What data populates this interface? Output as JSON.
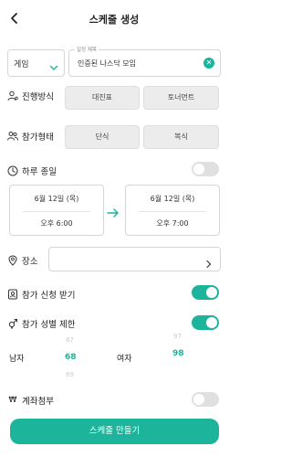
{
  "header": {
    "title": "스케줄 생성",
    "back_icon": "back-arrow-icon"
  },
  "game": {
    "value": "게임"
  },
  "title_field": {
    "label": "일정 제목",
    "value": "인증된 나스닥 모임"
  },
  "progress": {
    "label": "진행방식",
    "options": [
      "대진표",
      "토너먼트"
    ]
  },
  "participation": {
    "label": "참가형태",
    "options": [
      "단식",
      "복식"
    ]
  },
  "all_day": {
    "label": "하루 종일",
    "enabled": false
  },
  "start": {
    "date": "6월 12일 (목)",
    "time": "오후 6:00"
  },
  "end": {
    "date": "6월 12일 (목)",
    "time": "오후 7:00"
  },
  "place": {
    "label": "장소",
    "value": ""
  },
  "apply": {
    "label": "참가 신청 받기",
    "enabled": true
  },
  "gender_limit": {
    "label": "참가 성별 제한",
    "enabled": true,
    "male": {
      "label": "남자",
      "above": "67",
      "selected": "68",
      "below": "69"
    },
    "female": {
      "label": "여자",
      "above": "97",
      "selected": "98"
    }
  },
  "account": {
    "label": "계좌첨부",
    "enabled": false
  },
  "submit": {
    "label": "스케줄 만들기"
  },
  "colors": {
    "accent": "#1cb59c",
    "toggle_off": "#e0e0e0",
    "button_bg": "#ececec"
  }
}
